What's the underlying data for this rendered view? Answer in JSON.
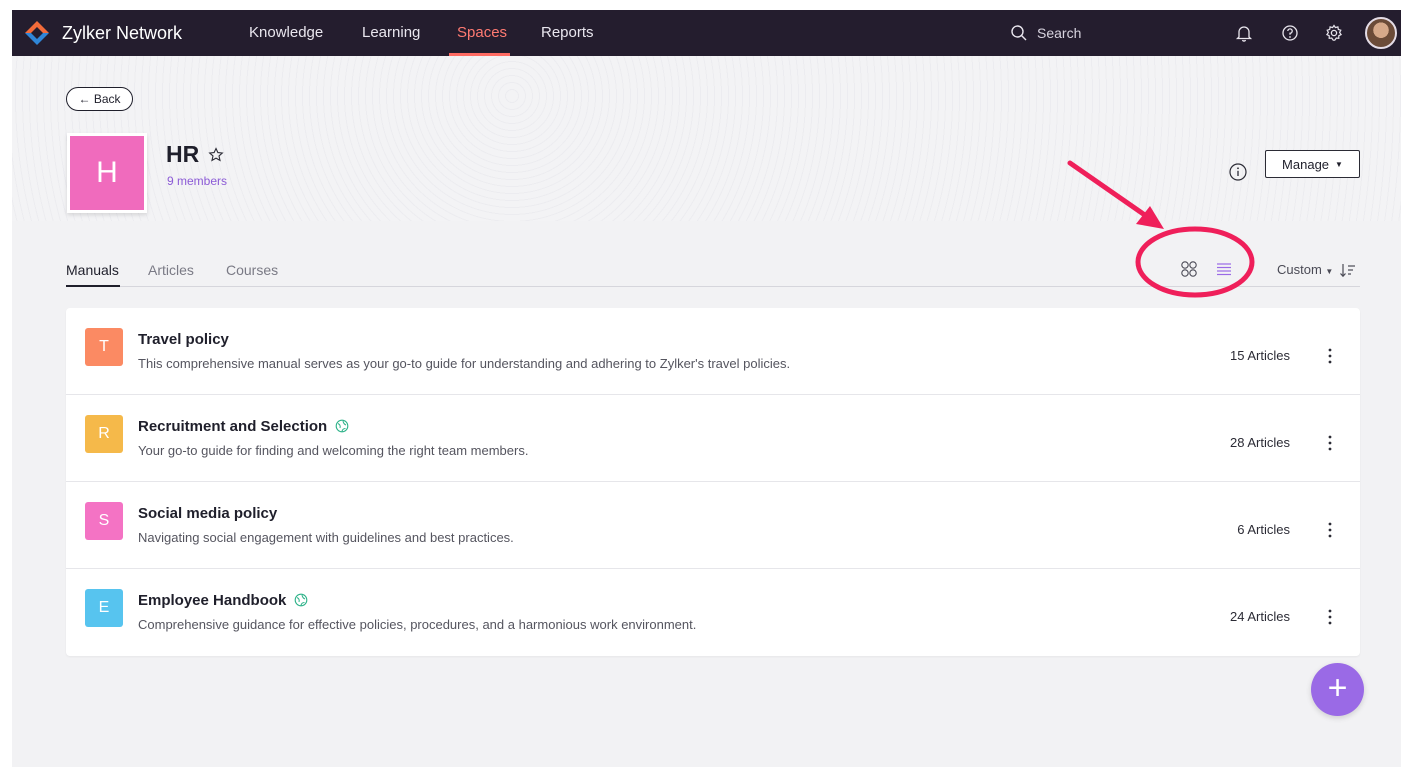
{
  "topbar": {
    "brand": "Zylker Network",
    "nav": [
      {
        "label": "Knowledge"
      },
      {
        "label": "Learning"
      },
      {
        "label": "Spaces"
      },
      {
        "label": "Reports"
      }
    ],
    "search_label": "Search"
  },
  "header": {
    "back_label": "← Back",
    "tile_letter": "H",
    "space_name": "HR",
    "members": "9 members",
    "manage_label": "Manage",
    "tile_color": "#f06bbd"
  },
  "tabs": [
    {
      "label": "Manuals"
    },
    {
      "label": "Articles"
    },
    {
      "label": "Courses"
    }
  ],
  "sort": {
    "label": "Custom"
  },
  "manuals": [
    {
      "letter": "T",
      "color": "#fb8a63",
      "title": "Travel policy",
      "description": "This comprehensive manual serves as your go-to guide for understanding and adhering to Zylker's travel policies.",
      "count": "15 Articles"
    },
    {
      "letter": "R",
      "color": "#f5b94a",
      "title": "Recruitment and Selection",
      "description": "Your go-to guide for finding and welcoming the right team members.",
      "count": "28 Articles"
    },
    {
      "letter": "S",
      "color": "#f473c4",
      "title": "Social media policy",
      "description": "Navigating social engagement with guidelines and best practices.",
      "count": "6 Articles"
    },
    {
      "letter": "E",
      "color": "#57c4ef",
      "title": "Employee Handbook",
      "description": "Comprehensive guidance for effective policies, procedures, and a harmonious work environment.",
      "count": "24 Articles"
    }
  ],
  "fab_label": "+",
  "colors": {
    "topbar": "#241d2e",
    "accent_nav": "#ff6b63",
    "annotation": "#ef1f5a",
    "fab": "#9a6ae6"
  }
}
